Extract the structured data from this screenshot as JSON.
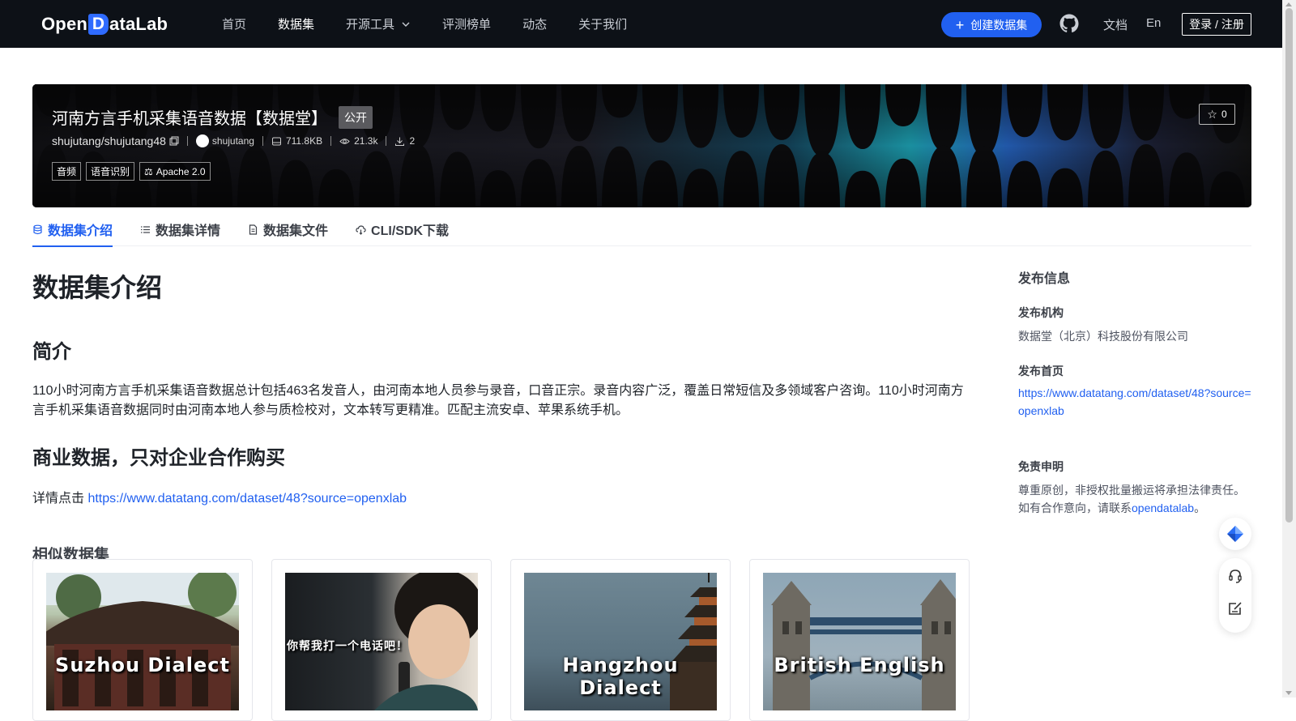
{
  "nav": {
    "logo_left": "Open",
    "logo_d": "D",
    "logo_right": "ataLab",
    "links": [
      "首页",
      "数据集",
      "开源工具",
      "评测榜单",
      "动态",
      "关于我们"
    ],
    "create_label": "创建数据集",
    "docs_label": "文档",
    "lang_label": "En",
    "login_label": "登录 / 注册"
  },
  "dataset": {
    "title": "河南方言手机采集语音数据【数据堂】",
    "visibility": "公开",
    "path": "shujutang/shujutang48",
    "owner": "shujutang",
    "size": "711.8KB",
    "views": "21.3k",
    "downloads": "2",
    "tags": [
      "音频",
      "语音识别"
    ],
    "license": "Apache 2.0",
    "stars": "0"
  },
  "tabs": [
    "数据集介绍",
    "数据集详情",
    "数据集文件",
    "CLI/SDK下载"
  ],
  "content": {
    "heading": "数据集介绍",
    "intro_heading": "简介",
    "intro_text": "110小时河南方言手机采集语音数据总计包括463名发音人，由河南本地人员参与录音，口音正宗。录音内容广泛，覆盖日常短信及多领域客户咨询。110小时河南方言手机采集语音数据同时由河南本地人参与质检校对，文本转写更精准。匹配主流安卓、苹果系统手机。",
    "biz_heading": "商业数据，只对企业合作购买",
    "detail_prefix": "详情点击 ",
    "detail_link": "https://www.datatang.com/dataset/48?source=openxlab",
    "similar_heading": "相似数据集",
    "similar_cards": [
      {
        "caption": "Suzhou Dialect"
      },
      {
        "caption": "你帮我打一个电话吧！"
      },
      {
        "caption": "Hangzhou Dialect"
      },
      {
        "caption": "British English"
      }
    ]
  },
  "sidebar": {
    "title": "发布信息",
    "org_label": "发布机构",
    "org_value": "数据堂（北京）科技股份有限公司",
    "home_label": "发布首页",
    "home_link_1": "https://www.datatang.com/dataset/48?source=",
    "home_link_2": "openxlab",
    "disclaimer_label": "免责申明",
    "disclaimer_line1": "尊重原创，非授权批量搬运将承担法律责任。",
    "disclaimer_line2_prefix": "如有合作意向，请联系",
    "disclaimer_link": "opendatalab",
    "disclaimer_line2_suffix": "。"
  },
  "colors": {
    "accent": "#2160f0",
    "nav_bg": "#0d1117",
    "banner_bg": "#141416"
  }
}
